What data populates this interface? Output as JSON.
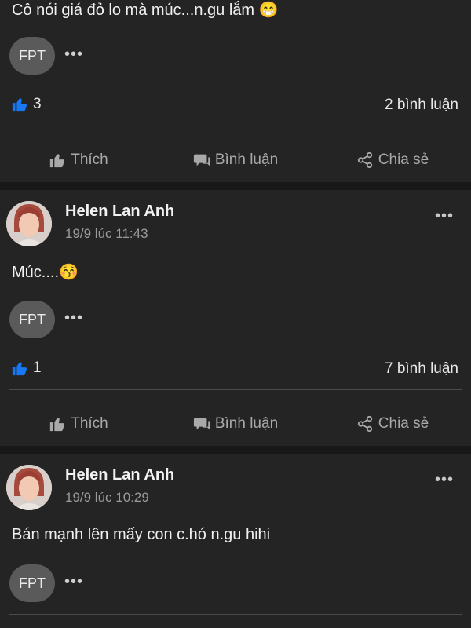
{
  "post0": {
    "text": "Cô nói giá đỏ lo mà múc...n.gu lắm 😁",
    "page_badge": "FPT",
    "more": "•••",
    "likes": "3",
    "comments": "2 bình luận",
    "actions": {
      "like": "Thích",
      "comment": "Bình luận",
      "share": "Chia sẻ"
    }
  },
  "post1": {
    "name": "Helen Lan Anh",
    "time": "19/9 lúc 11:43",
    "more": "•••",
    "text": "Múc....😚",
    "page_badge": "FPT",
    "badge_more": "•••",
    "likes": "1",
    "comments": "7 bình luận",
    "actions": {
      "like": "Thích",
      "comment": "Bình luận",
      "share": "Chia sẻ"
    }
  },
  "post2": {
    "name": "Helen Lan Anh",
    "time": "19/9 lúc 10:29",
    "more": "•••",
    "text": "Bán mạnh lên mấy con c.hó n.gu hihi",
    "page_badge": "FPT",
    "badge_more": "•••"
  },
  "colors": {
    "like_blue": "#1877f2",
    "background": "#242424",
    "separator": "#181818"
  },
  "icons": [
    "thumbs-up-icon",
    "comment-icon",
    "share-icon",
    "more-icon",
    "like-reaction-icon"
  ]
}
